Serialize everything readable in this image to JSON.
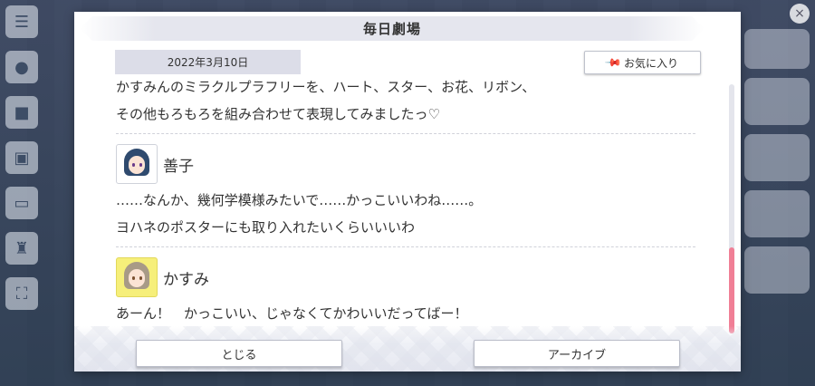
{
  "dialog": {
    "title": "毎日劇場",
    "date": "2022年3月10日",
    "favorite_label": "お気に入り",
    "favorite_icon": "pin-icon"
  },
  "messages": [
    {
      "speaker": null,
      "lines": [
        "かすみんのミラクルプラフリーを、ハート、スター、お花、リボン、",
        "その他もろもろを組み合わせて表現してみましたっ♡"
      ]
    },
    {
      "speaker": "善子",
      "avatar_color": "#ffffff",
      "lines": [
        "……なんか、幾何学模様みたいで……かっこいいわね……。",
        "ヨハネのポスターにも取り入れたいくらいいいわ"
      ]
    },
    {
      "speaker": "かすみ",
      "avatar_color": "#f6ef7a",
      "lines": [
        "あーん！　かっこいい、じゃなくてかわいいだってばー！"
      ]
    }
  ],
  "footer": {
    "close_label": "とじる",
    "archive_label": "アーカイブ"
  },
  "scrollbar": {
    "thumb_color": "#f07f96",
    "position": "bottom"
  }
}
